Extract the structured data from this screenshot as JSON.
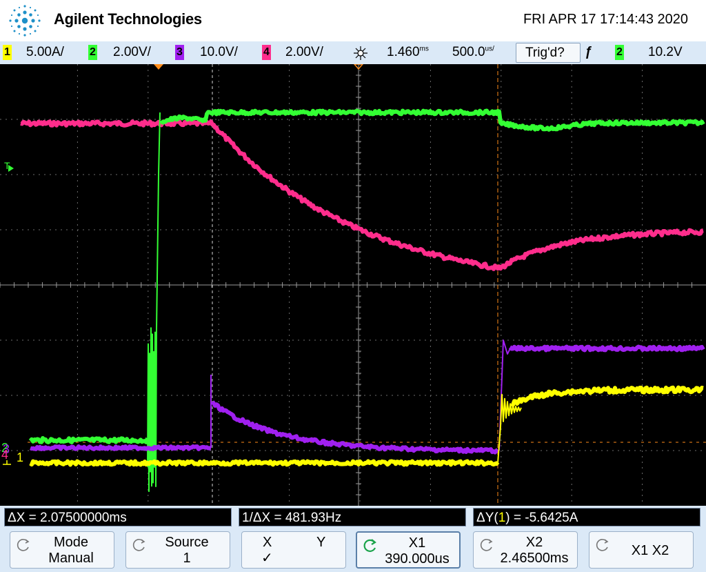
{
  "header": {
    "brand": "Agilent Technologies",
    "datetime": "FRI APR 17 17:14:43 2020"
  },
  "status_bar": {
    "ch1": {
      "num": "1",
      "scale": "5.00A/",
      "color": "#ffff00"
    },
    "ch2": {
      "num": "2",
      "scale": "2.00V/",
      "color": "#33ff33"
    },
    "ch3": {
      "num": "3",
      "scale": "10.0V/",
      "color": "#a020f0"
    },
    "ch4": {
      "num": "4",
      "scale": "2.00V/",
      "color": "#ff2d8c"
    },
    "delay": "1.460",
    "delay_unit": "ms",
    "timebase": "500.0",
    "timebase_unit": "us/",
    "trigger_status": "Trig'd?",
    "trigger_channel": "2",
    "trigger_level": "10.2V"
  },
  "screen": {
    "trigger_marker": "T",
    "markers": {
      "ch1": "1",
      "ch2": "2",
      "ch3": "3",
      "ch4": "4"
    }
  },
  "measurements": {
    "delta_x": "ΔX = 2.07500000ms",
    "inv_delta_x": "1/ΔX = 481.93Hz",
    "delta_y_prefix": "ΔY(",
    "delta_y_channel": "1",
    "delta_y_suffix": ") = -5.6425A"
  },
  "softkeys": {
    "mode": {
      "line1": "Mode",
      "line2": "Manual"
    },
    "source": {
      "line1": "Source",
      "line2": "1"
    },
    "xy": {
      "x": "X",
      "y": "Y",
      "check": "✓"
    },
    "x1": {
      "line1": "X1",
      "line2": "390.000us"
    },
    "x2": {
      "line1": "X2",
      "line2": "2.46500ms"
    },
    "x1x2": {
      "line1": "X1 X2"
    }
  },
  "colors": {
    "ch1": "#ffff00",
    "ch2": "#33ff33",
    "ch3": "#a020f0",
    "ch4": "#ff2d8c",
    "cursor": "#ff8c1a",
    "grid": "#6e6e6e",
    "accent_blue": "#1e90c8"
  }
}
